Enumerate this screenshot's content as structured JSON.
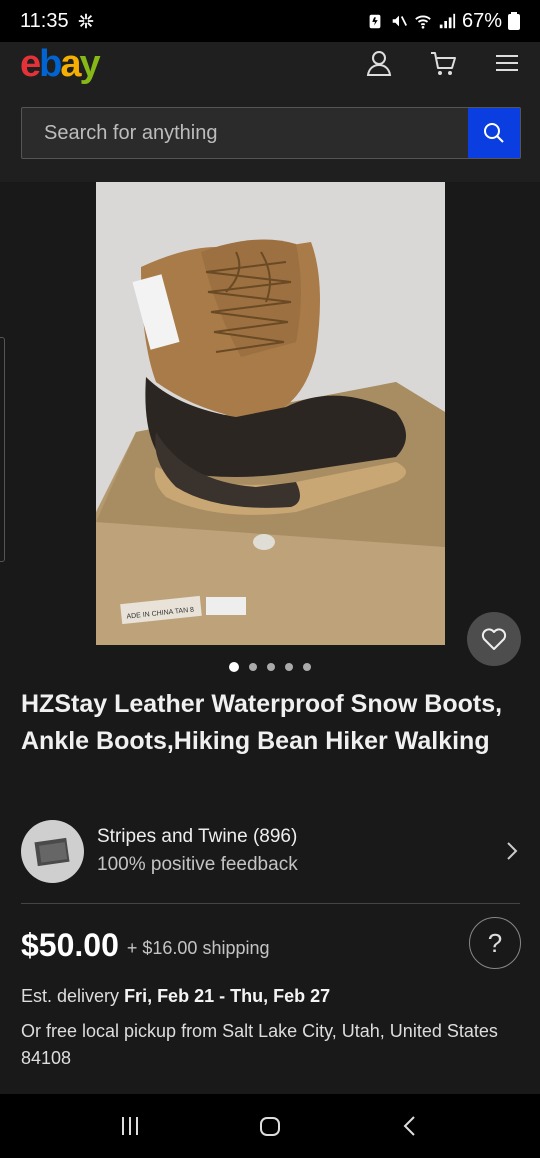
{
  "status_bar": {
    "time": "11:35",
    "battery": "67%"
  },
  "header": {
    "logo_letters": [
      "e",
      "b",
      "a",
      "y"
    ],
    "search": {
      "placeholder": "Search for anything"
    }
  },
  "gallery": {
    "image_count": 5,
    "active_index": 0,
    "box_label": "ADE IN CHINA TAN 8"
  },
  "listing": {
    "title": "HZStay Leather Waterproof Snow Boots, Ankle Boots,Hiking Bean Hiker Walking",
    "seller": {
      "name": "Stripes and Twine (896)",
      "feedback": "100% positive feedback"
    },
    "price": "$50.00",
    "shipping": "+ $16.00 shipping",
    "help": "?",
    "delivery_label": "Est. delivery",
    "delivery_dates": "Fri, Feb 21 - Thu, Feb 27",
    "pickup": "Or free local pickup from Salt Lake City, Utah, United States 84108"
  },
  "colors": {
    "ebay_red": "#e53238",
    "ebay_blue": "#0064d2",
    "ebay_yellow": "#f5af02",
    "ebay_green": "#86b817",
    "search_button": "#0b3ee0"
  }
}
